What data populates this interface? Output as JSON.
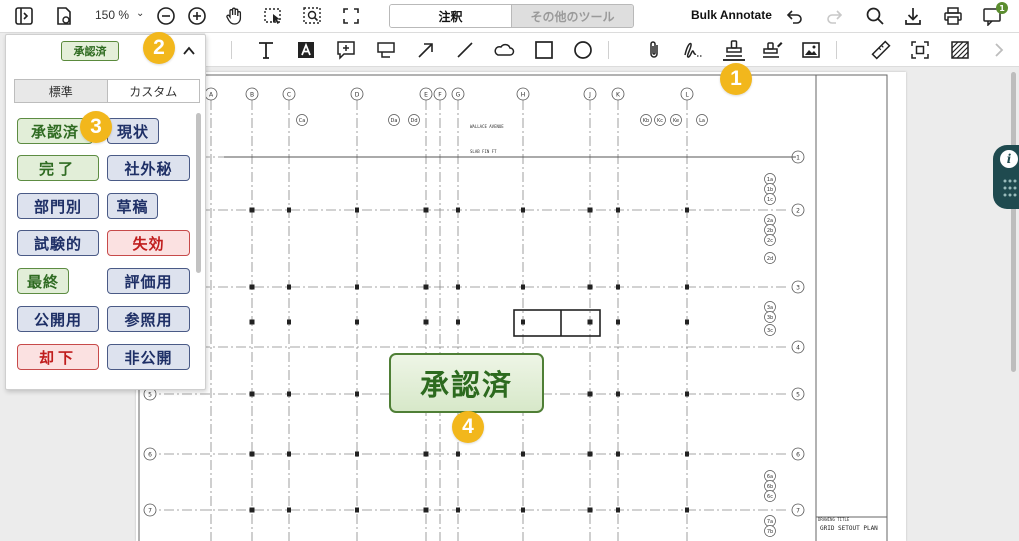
{
  "toolbar": {
    "zoom": "150 %",
    "mode_tabs": [
      {
        "label": "注釈",
        "active": true
      },
      {
        "label": "その他のツール",
        "active": false
      }
    ],
    "bulk_annotate": "Bulk Annotate",
    "notification_count": "1"
  },
  "annotation_tools": [
    "text-tool-icon",
    "text-box-icon",
    "comment-icon",
    "callout-icon",
    "arrow-icon",
    "line-icon",
    "cloud-icon",
    "rectangle-icon",
    "ellipse-icon",
    "attachment-icon",
    "signature-icon",
    "stamp-icon",
    "custom-stamp-icon",
    "image-icon",
    "measure-icon",
    "crop-icon",
    "redact-icon",
    "chevron-right-icon"
  ],
  "stamp_panel": {
    "selected_stamp": "承認済",
    "tabs": [
      {
        "label": "標準",
        "active": true
      },
      {
        "label": "カスタム",
        "active": false
      }
    ],
    "stamps": [
      {
        "label": "承認済",
        "color": "green"
      },
      {
        "label": "現状",
        "color": "blue"
      },
      {
        "label": "完了",
        "color": "green"
      },
      {
        "label": "社外秘",
        "color": "blue"
      },
      {
        "label": "部門別",
        "color": "blue"
      },
      {
        "label": "草稿",
        "color": "blue"
      },
      {
        "label": "試験的",
        "color": "blue"
      },
      {
        "label": "失効",
        "color": "red"
      },
      {
        "label": "最終",
        "color": "green"
      },
      {
        "label": "評価用",
        "color": "blue"
      },
      {
        "label": "公開用",
        "color": "blue"
      },
      {
        "label": "参照用",
        "color": "blue"
      },
      {
        "label": "却下",
        "color": "red"
      },
      {
        "label": "非公開",
        "color": "blue"
      }
    ]
  },
  "document": {
    "placed_stamp": "承認済",
    "drawing_text": {
      "street": "WALLACE AVENUE",
      "slab_note": "SLAB   FIN FT",
      "title_block_top": "DRAWING TITLE",
      "title_block_name": "GRID SETOUT PLAN",
      "column_labels": [
        "A",
        "B",
        "C",
        "D",
        "E",
        "F",
        "G",
        "H",
        "J",
        "K",
        "L"
      ],
      "row_labels": [
        "1",
        "1a",
        "1b",
        "1c",
        "1d",
        "2",
        "2a",
        "2b",
        "2c",
        "2d",
        "3",
        "3a",
        "3b",
        "3c",
        "4",
        "5",
        "6",
        "6a",
        "6b",
        "6c",
        "7",
        "7a",
        "7b",
        "7c"
      ],
      "sub_column_labels": [
        "Ca",
        "Da",
        "Dd",
        "Kb",
        "Kc",
        "Ke",
        "La"
      ]
    }
  },
  "callouts": [
    "1",
    "2",
    "3",
    "4"
  ],
  "colors": {
    "accent": "#f2b71c",
    "stamp_green": "#2f6b22",
    "stamp_blue": "#1e2f66",
    "stamp_red": "#c01d1d",
    "side_panel": "#1f4a4f"
  }
}
